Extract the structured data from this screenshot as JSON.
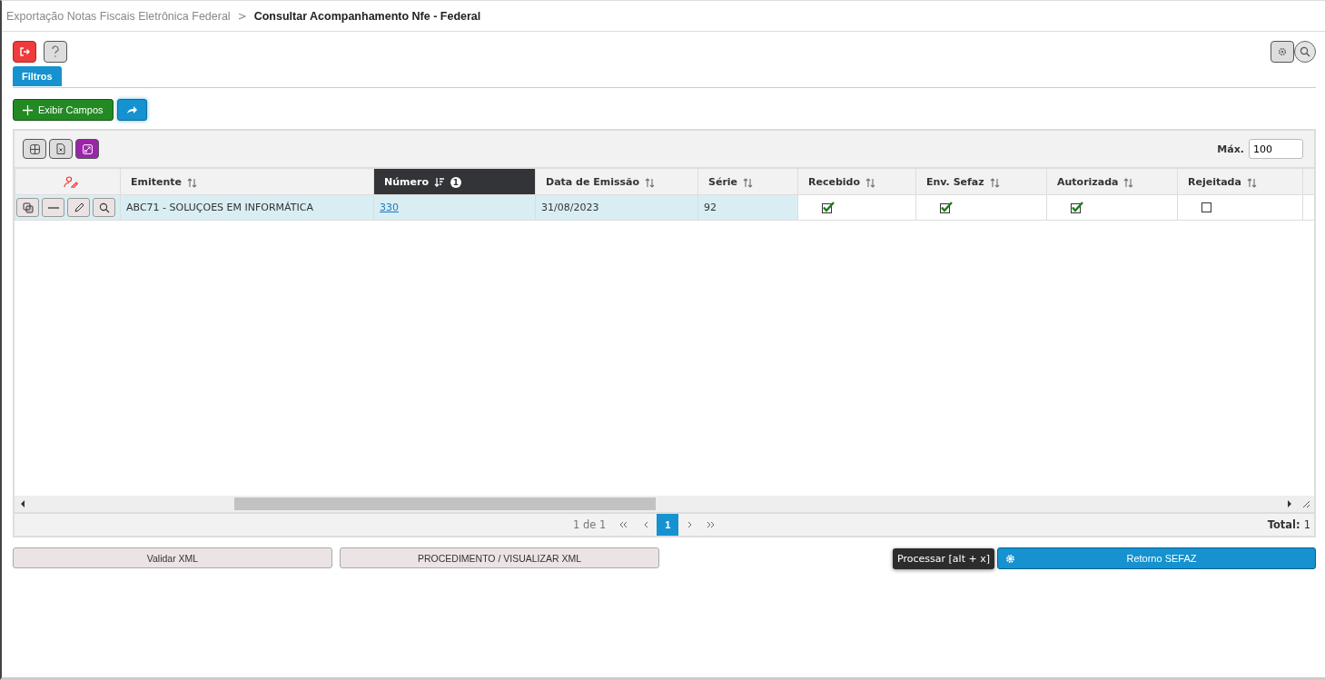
{
  "breadcrumb": {
    "parent": "Exportação Notas Fiscais Eletrônica Federal",
    "separator": ">",
    "current": "Consultar Acompanhamento Nfe - Federal"
  },
  "tabs": [
    {
      "label": "Filtros",
      "selected": true
    }
  ],
  "toolbar": {
    "show_fields_button": "Exibir Campos"
  },
  "grid": {
    "max_label": "Máx.",
    "max_value": "100",
    "columns": [
      {
        "label": "Emitente",
        "sorted": false
      },
      {
        "label": "Número",
        "sorted": true,
        "sort_order": "1"
      },
      {
        "label": "Data de Emissão",
        "sorted": false
      },
      {
        "label": "Série",
        "sorted": false
      },
      {
        "label": "Recebido",
        "sorted": false
      },
      {
        "label": "Env. Sefaz",
        "sorted": false
      },
      {
        "label": "Autorizada",
        "sorted": false
      },
      {
        "label": "Rejeitada",
        "sorted": false
      }
    ],
    "rows": [
      {
        "selected": true,
        "cells": [
          {
            "kind": "text",
            "text": "ABC71 - SOLUÇOES EM INFORMÁTICA"
          },
          {
            "kind": "link",
            "text": "330"
          },
          {
            "kind": "text",
            "text": "31/08/2023"
          },
          {
            "kind": "text",
            "text": "92"
          },
          {
            "kind": "check",
            "checked": true
          },
          {
            "kind": "check",
            "checked": true
          },
          {
            "kind": "check",
            "checked": true
          },
          {
            "kind": "check",
            "checked": false
          }
        ]
      }
    ],
    "pagination": {
      "summary": "1 de 1",
      "pages": [
        {
          "label": "1",
          "selected": true
        }
      ],
      "total_label": "Total:",
      "total": "1"
    }
  },
  "actions": [
    "Validar XML",
    "PROCEDIMENTO / VISUALIZAR XML"
  ],
  "tooltip": "Processar [alt + x]",
  "primary_action": "Retorno SEFAZ"
}
